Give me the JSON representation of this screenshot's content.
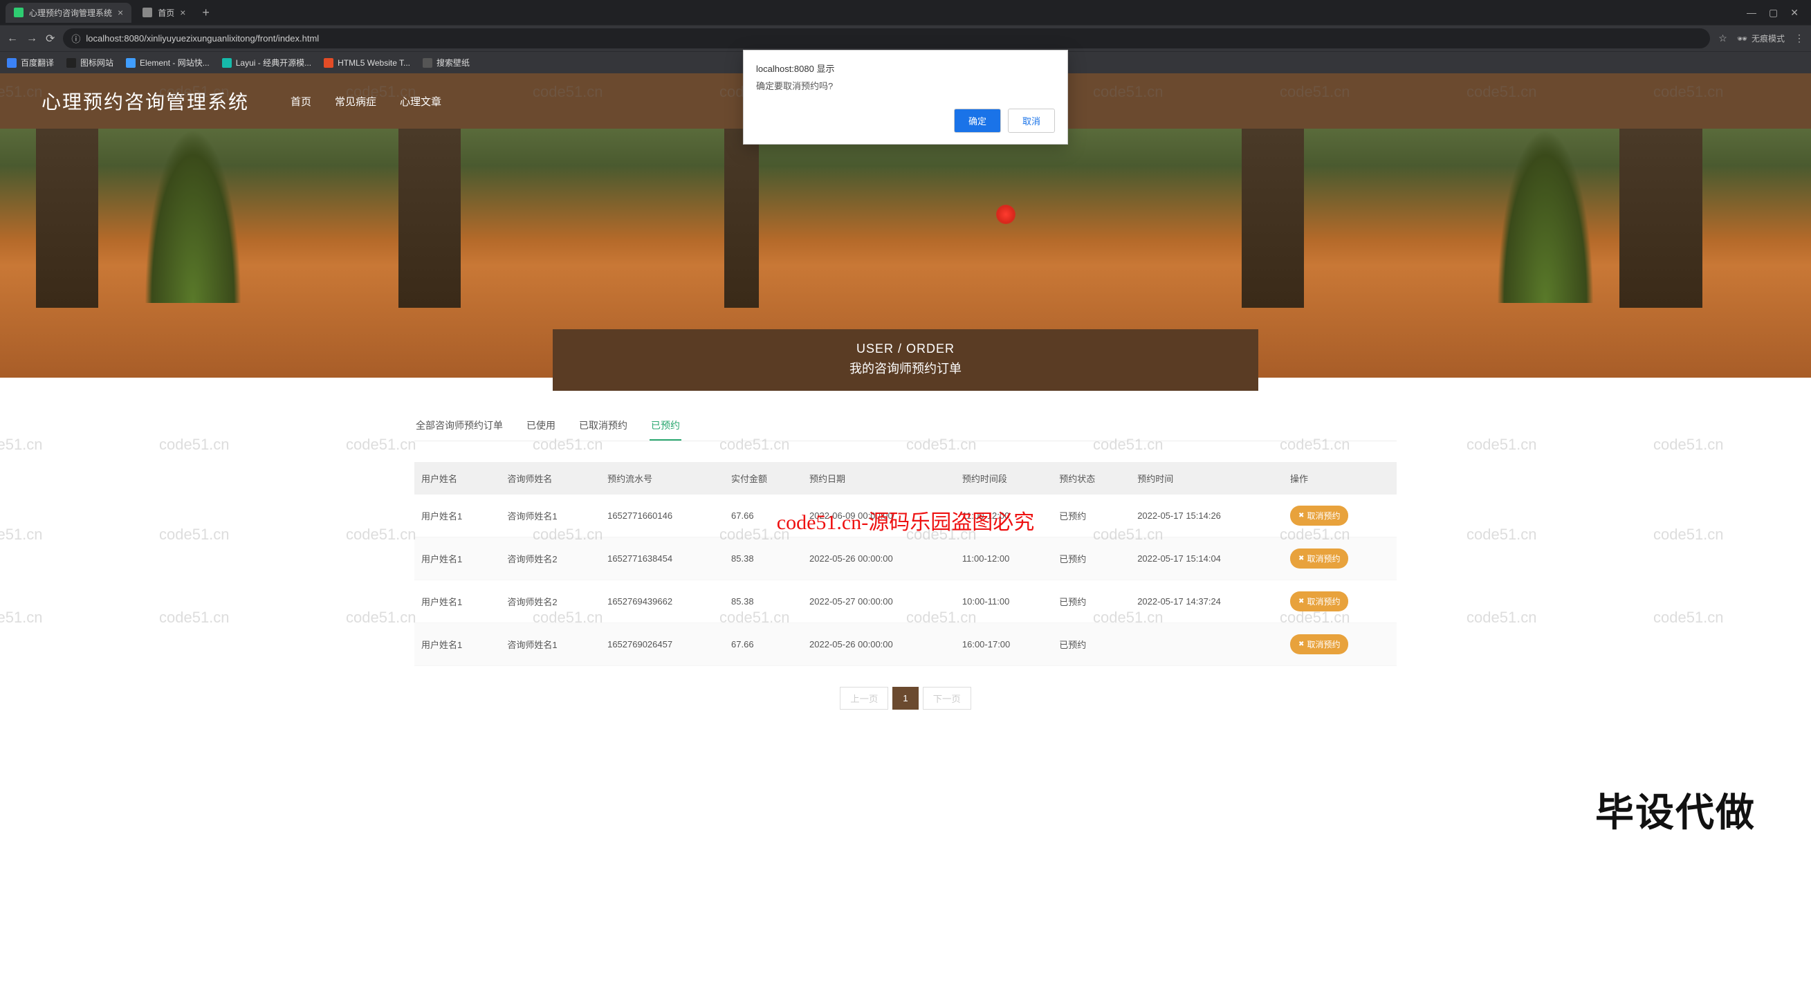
{
  "browser": {
    "tabs": [
      {
        "title": "心理预约咨询管理系统",
        "active": true,
        "favicon": "#2ecc71"
      },
      {
        "title": "首页",
        "active": false,
        "favicon": "#888"
      }
    ],
    "url": "localhost:8080/xinliyuyuezixunguanlixitong/front/index.html",
    "incognito_label": "无痕模式",
    "bookmarks": [
      {
        "label": "百度翻译",
        "icon": "#3b82f6"
      },
      {
        "label": "图标网站",
        "icon": "#222"
      },
      {
        "label": "Element - 网站快...",
        "icon": "#409eff"
      },
      {
        "label": "Layui - 经典开源模...",
        "icon": "#16baaa"
      },
      {
        "label": "HTML5 Website T...",
        "icon": "#e34c26"
      },
      {
        "label": "搜索壁纸",
        "icon": "#555"
      }
    ]
  },
  "dialog": {
    "host": "localhost:8080 显示",
    "message": "确定要取消预约吗?",
    "ok": "确定",
    "cancel": "取消"
  },
  "header": {
    "site_title": "心理预约咨询管理系统",
    "nav": [
      "首页",
      "常见病症",
      "心理文章"
    ]
  },
  "section": {
    "en": "USER / ORDER",
    "cn": "我的咨询师预约订单"
  },
  "watermark": {
    "red_text": "code51.cn-源码乐园盗图必究",
    "big_text": "毕设代做",
    "cell": "code51.cn"
  },
  "tabs": {
    "items": [
      "全部咨询师预约订单",
      "已使用",
      "已取消预约",
      "已预约"
    ],
    "active_index": 3
  },
  "table": {
    "columns": [
      "用户姓名",
      "咨询师姓名",
      "预约流水号",
      "实付金额",
      "预约日期",
      "预约时间段",
      "预约状态",
      "预约时间",
      "操作"
    ],
    "action_label": "取消预约",
    "rows": [
      {
        "user": "用户姓名1",
        "counselor": "咨询师姓名1",
        "serial": "1652771660146",
        "amount": "67.66",
        "date": "2022-06-09 00:00:00",
        "slot": "11:00-12:00",
        "status": "已预约",
        "time": "2022-05-17 15:14:26"
      },
      {
        "user": "用户姓名1",
        "counselor": "咨询师姓名2",
        "serial": "1652771638454",
        "amount": "85.38",
        "date": "2022-05-26 00:00:00",
        "slot": "11:00-12:00",
        "status": "已预约",
        "time": "2022-05-17 15:14:04"
      },
      {
        "user": "用户姓名1",
        "counselor": "咨询师姓名2",
        "serial": "1652769439662",
        "amount": "85.38",
        "date": "2022-05-27 00:00:00",
        "slot": "10:00-11:00",
        "status": "已预约",
        "time": "2022-05-17 14:37:24"
      },
      {
        "user": "用户姓名1",
        "counselor": "咨询师姓名1",
        "serial": "1652769026457",
        "amount": "67.66",
        "date": "2022-05-26 00:00:00",
        "slot": "16:00-17:00",
        "status": "已预约",
        "time": ""
      }
    ]
  },
  "pagination": {
    "prev": "上一页",
    "next": "下一页",
    "pages": [
      "1"
    ],
    "current": 0
  }
}
